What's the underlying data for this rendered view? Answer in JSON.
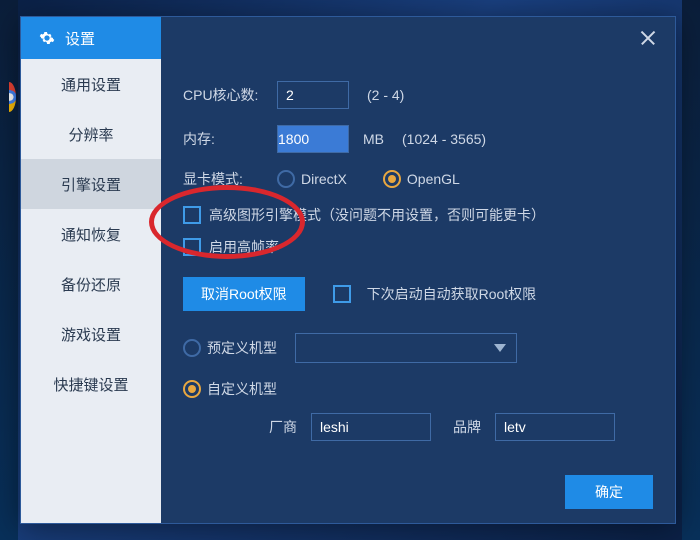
{
  "window": {
    "title": "设置",
    "sidebar": [
      {
        "label": "通用设置",
        "id": "general"
      },
      {
        "label": "分辨率",
        "id": "resolution"
      },
      {
        "label": "引擎设置",
        "id": "engine"
      },
      {
        "label": "通知恢复",
        "id": "notify"
      },
      {
        "label": "备份还原",
        "id": "backup"
      },
      {
        "label": "游戏设置",
        "id": "game"
      },
      {
        "label": "快捷键设置",
        "id": "hotkey"
      }
    ],
    "active_sidebar": "engine"
  },
  "engine": {
    "cpu_label": "CPU核心数:",
    "cpu_value": "2",
    "cpu_range": "(2 - 4)",
    "mem_label": "内存:",
    "mem_value": "1800",
    "mem_unit": "MB",
    "mem_range": "(1024 - 3565)",
    "gpu_label": "显卡模式:",
    "gpu_options": [
      "DirectX",
      "OpenGL"
    ],
    "gpu_selected": "OpenGL",
    "adv_graphics_label": "高级图形引擎模式（没问题不用设置，否则可能更卡）",
    "high_fps_label": "启用高帧率",
    "root_cancel_btn": "取消Root权限",
    "root_auto_label": "下次启动自动获取Root权限",
    "preset_model_label": "预定义机型",
    "custom_model_label": "自定义机型",
    "model_selected": "custom",
    "vendor_label": "厂商",
    "vendor_value": "leshi",
    "brand_label": "品牌",
    "brand_value": "letv",
    "ok_btn": "确定"
  }
}
